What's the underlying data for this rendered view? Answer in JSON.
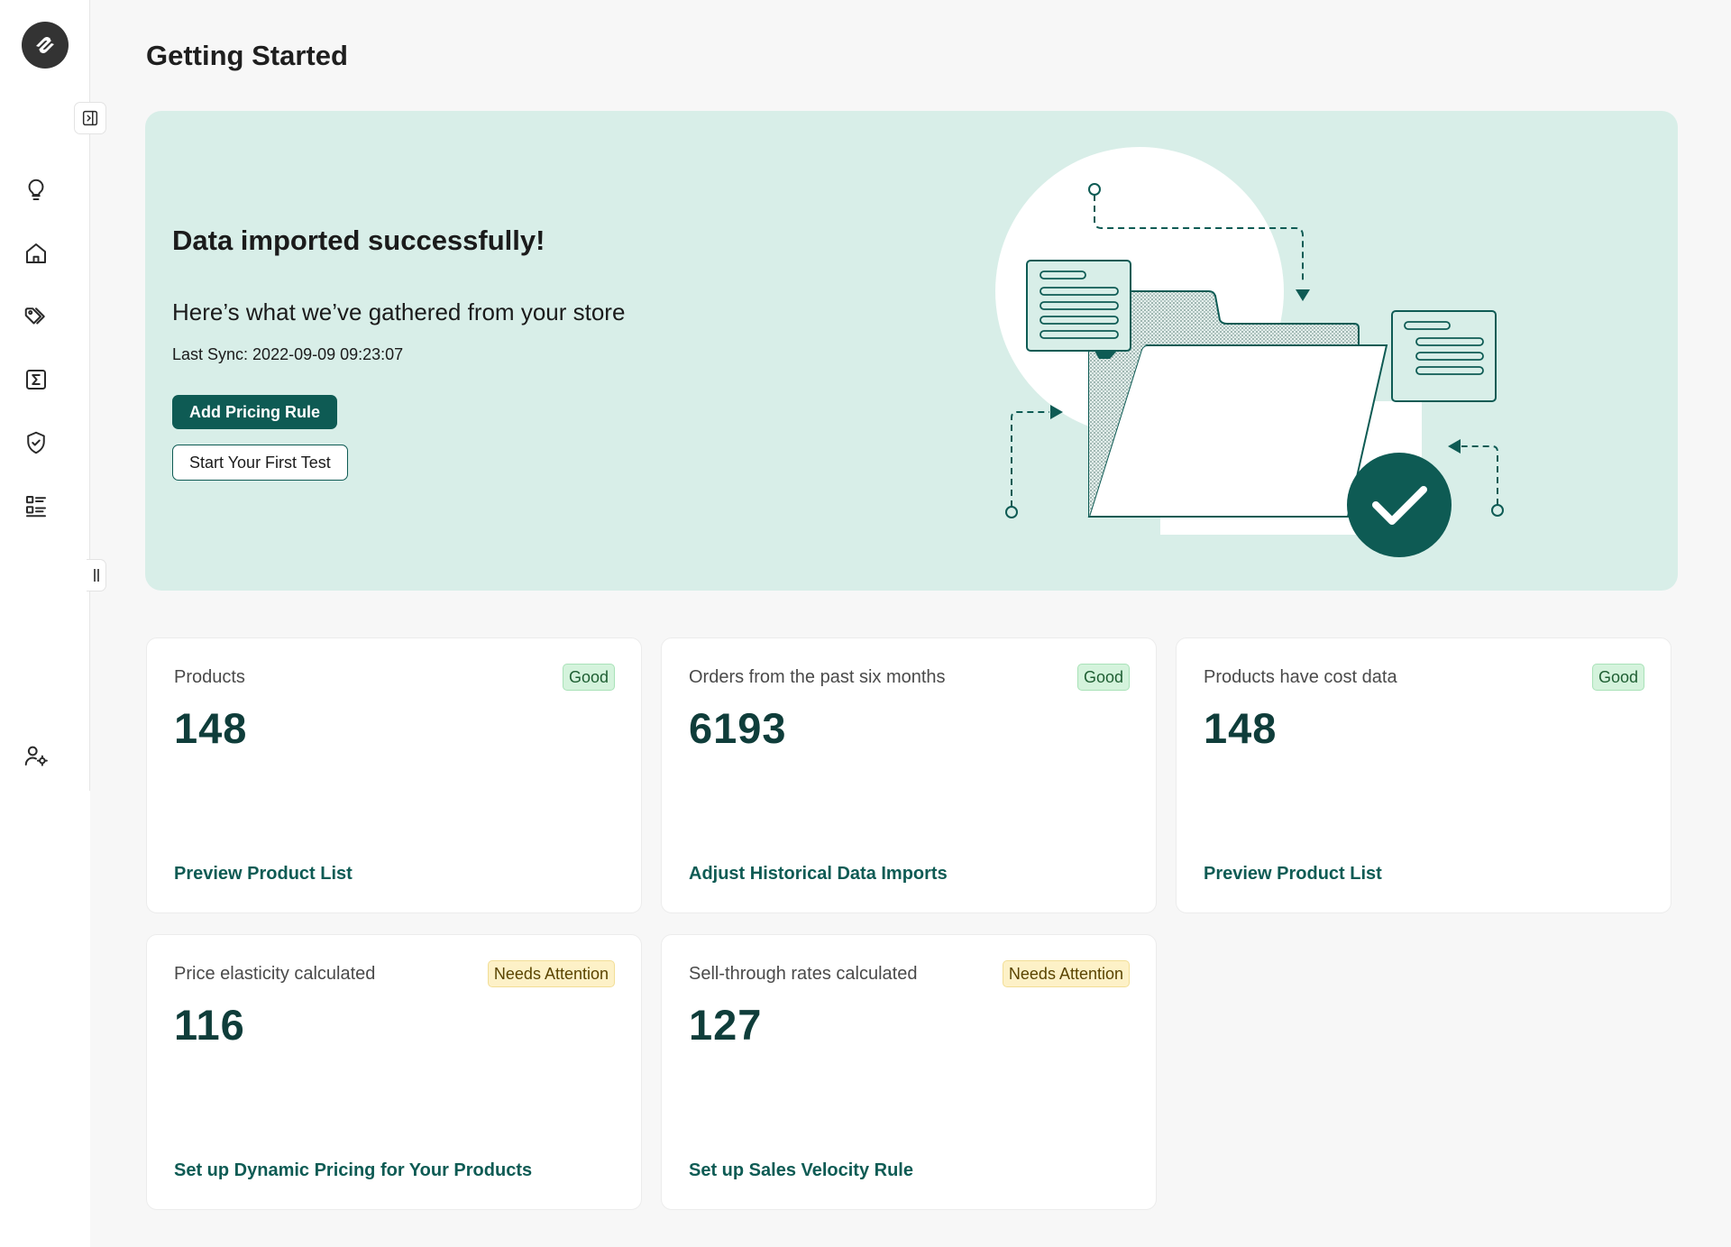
{
  "header": {
    "title": "Getting Started"
  },
  "sidebar": {
    "logo": "app-logo",
    "toggle_icon": "sidebar-collapse-icon",
    "items": [
      {
        "name": "tips",
        "icon": "lightbulb-icon"
      },
      {
        "name": "home",
        "icon": "home-icon"
      },
      {
        "name": "pricing",
        "icon": "tags-icon"
      },
      {
        "name": "formulas",
        "icon": "sigma-icon"
      },
      {
        "name": "protection",
        "icon": "shield-check-icon"
      },
      {
        "name": "list",
        "icon": "list-icon"
      }
    ],
    "account_icon": "user-settings-icon"
  },
  "hero": {
    "heading": "Data imported successfully!",
    "subheading": "Here’s what we’ve gathered from your store",
    "last_sync": "Last Sync: 2022-09-09 09:23:07",
    "primary_button": "Add Pricing Rule",
    "secondary_button": "Start Your First Test"
  },
  "cards": [
    {
      "label": "Products",
      "badge": "Good",
      "value": "148",
      "link": "Preview Product List"
    },
    {
      "label": "Orders from the past six months",
      "badge": "Good",
      "value": "6193",
      "link": "Adjust Historical Data Imports"
    },
    {
      "label": "Products have cost data",
      "badge": "Good",
      "value": "148",
      "link": "Preview Product List"
    },
    {
      "label": "Price elasticity calculated",
      "badge": "Needs Attention",
      "value": "116",
      "link": "Set up Dynamic Pricing for Your Products"
    },
    {
      "label": "Sell-through rates calculated",
      "badge": "Needs Attention",
      "value": "127",
      "link": "Set up Sales Velocity Rule"
    }
  ],
  "colors": {
    "accent": "#0e5b54",
    "hero_bg": "#d8eee8",
    "good_badge_bg": "#d4f3dc",
    "attention_badge_bg": "#fdf1c7"
  }
}
